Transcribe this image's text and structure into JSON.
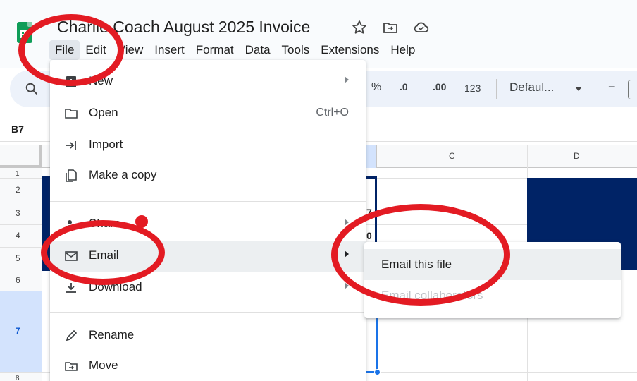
{
  "app": {
    "title": "Charlie Coach August 2025 Invoice",
    "title_icons": [
      "star-icon",
      "move-to-folder-icon",
      "cloud-status-icon"
    ]
  },
  "menubar": [
    "File",
    "Edit",
    "View",
    "Insert",
    "Format",
    "Data",
    "Tools",
    "Extensions",
    "Help"
  ],
  "toolbar": {
    "percent": "%",
    "decrease_decimal": ".0",
    "increase_decimal": ".00",
    "number_format": "123",
    "font": "Defaul...",
    "zoom_minus": "−"
  },
  "name_box": "B7",
  "columns": [
    "C",
    "D"
  ],
  "rows": [
    "1",
    "2",
    "3",
    "4",
    "5",
    "6",
    "7",
    "8"
  ],
  "cell_fragments": [
    "7",
    "0"
  ],
  "file_menu": {
    "items": [
      {
        "label": "New",
        "icon": "new-sheet-icon",
        "submenu": true
      },
      {
        "label": "Open",
        "icon": "folder-open-icon",
        "shortcut": "Ctrl+O"
      },
      {
        "label": "Import",
        "icon": "import-icon"
      },
      {
        "label": "Make a copy",
        "icon": "copy-icon"
      },
      {
        "label": "Share",
        "icon": "share-icon",
        "submenu": true
      },
      {
        "label": "Email",
        "icon": "mail-icon",
        "submenu": true
      },
      {
        "label": "Download",
        "icon": "download-icon",
        "submenu": true
      },
      {
        "label": "Rename",
        "icon": "pencil-icon"
      },
      {
        "label": "Move",
        "icon": "move-folder-icon"
      }
    ]
  },
  "email_submenu": {
    "items": [
      {
        "label": "Email this file",
        "enabled": true
      },
      {
        "label": "Email collaborators",
        "enabled": false
      }
    ]
  },
  "colors": {
    "annotation": "#e31b23",
    "navy_fill": "#002366",
    "selection": "#1a73e8",
    "sheets_green": "#0f9d58"
  }
}
